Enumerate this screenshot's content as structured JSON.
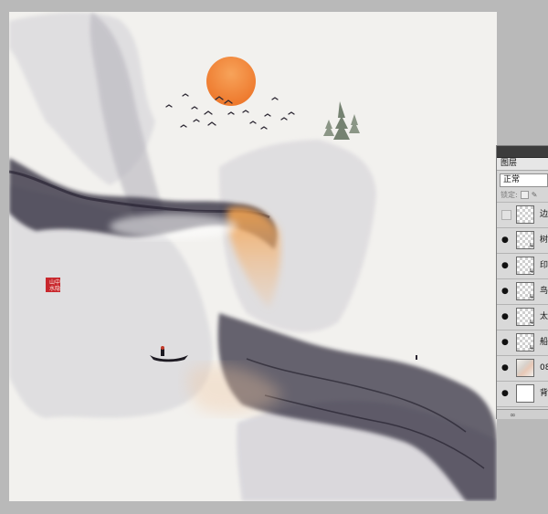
{
  "layers_panel": {
    "tab_label": "图层",
    "blend_mode": "正常",
    "lock_label": "锁定:",
    "layers": [
      {
        "name": "边",
        "visible": false,
        "thumb": "transparent",
        "linked": false
      },
      {
        "name": "树",
        "visible": true,
        "thumb": "transparent",
        "linked": true
      },
      {
        "name": "印",
        "visible": true,
        "thumb": "transparent",
        "linked": true
      },
      {
        "name": "鸟",
        "visible": true,
        "thumb": "transparent",
        "linked": true
      },
      {
        "name": "太",
        "visible": true,
        "thumb": "transparent",
        "linked": true
      },
      {
        "name": "船",
        "visible": true,
        "thumb": "transparent",
        "linked": true
      },
      {
        "name": "08",
        "visible": true,
        "thumb": "image",
        "linked": false
      },
      {
        "name": "背",
        "visible": true,
        "thumb": "white",
        "linked": false
      }
    ],
    "footer_glyph": "∞"
  },
  "artwork": {
    "seal_text": [
      "山",
      "中",
      "水",
      "隐"
    ],
    "sun_color": "#f08a3a",
    "ink_color": "#2c2838",
    "paper_color": "#f2f1ee"
  }
}
